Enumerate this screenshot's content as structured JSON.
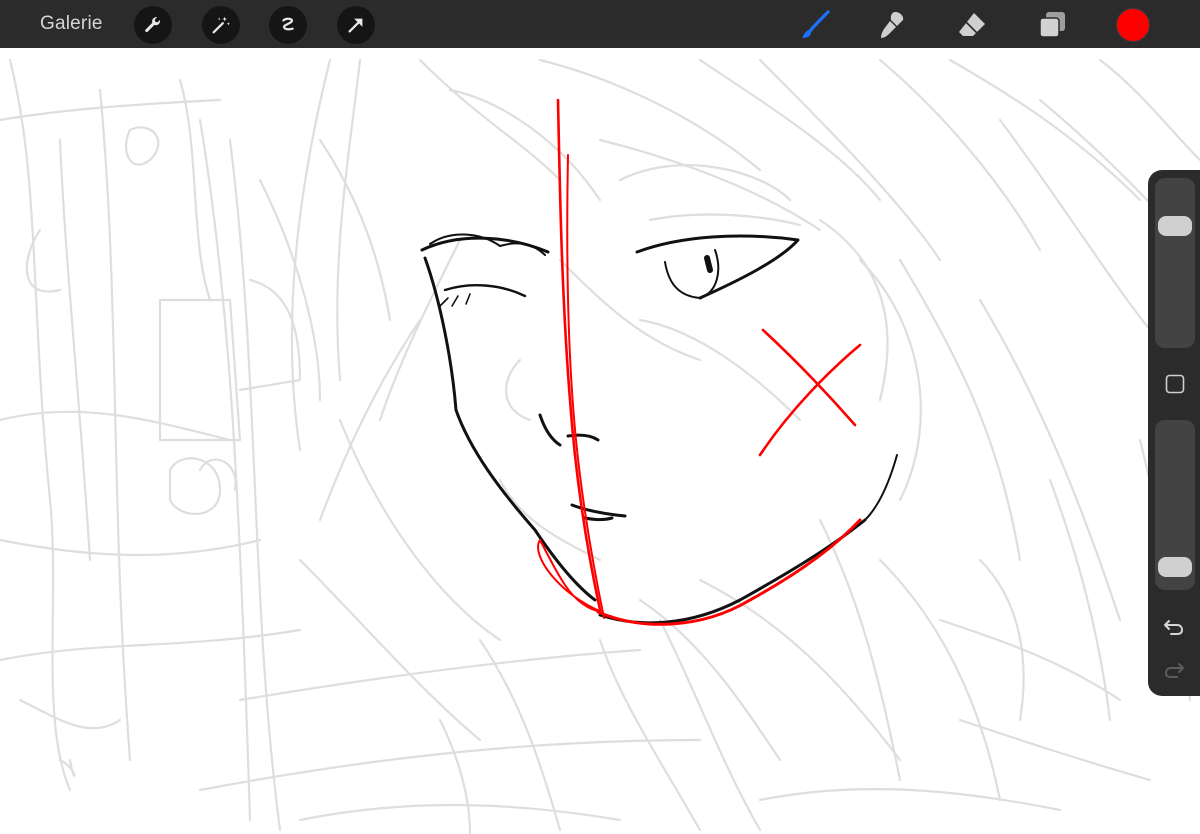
{
  "topbar": {
    "gallery_label": "Galerie",
    "left_tools": [
      "wrench-icon",
      "magic-wand-icon",
      "selection-icon",
      "transform-arrow-icon"
    ],
    "right_tools": [
      "brush-icon",
      "smudge-icon",
      "eraser-icon",
      "layers-icon"
    ],
    "active_tool": "brush-icon",
    "active_color": "#ff0000",
    "accent_color": "#1a73ff"
  },
  "sidebar": {
    "brush_size": 0.77,
    "opacity": 0.05,
    "controls": [
      "modify-button-icon",
      "undo-icon",
      "redo-icon"
    ],
    "redo_enabled": false
  },
  "canvas": {
    "background": "#ffffff",
    "sketch_line_color": "#dedede",
    "lineart_color": "#111111",
    "correction_color": "#ff0000"
  }
}
